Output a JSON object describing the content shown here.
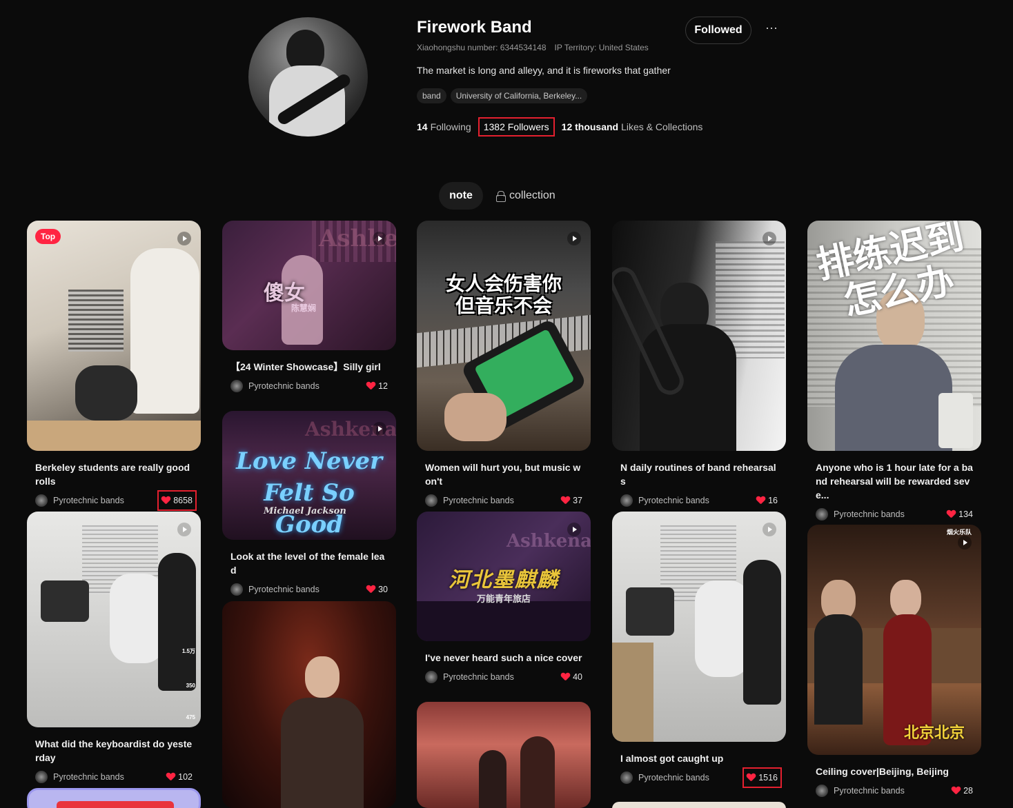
{
  "profile": {
    "name": "Firework Band",
    "xhs_number": "Xiaohongshu number: 6344534148",
    "ip": "IP Territory: United States",
    "description": "The market is long and alleyy, and it is fireworks that gather",
    "tags": [
      "band",
      "University of California, Berkeley..."
    ],
    "following_count": "14",
    "following_label": "Following",
    "followers_label": "1382 Followers",
    "likes_count": "12 thousand",
    "likes_label": "Likes & Collections",
    "followed_button": "Followed",
    "more_button": "···"
  },
  "tabs": {
    "note": "note",
    "collection": "collection"
  },
  "notes": [
    {
      "title": "Berkeley students are really good rolls",
      "author": "Pyrotechnic bands",
      "likes": "8658",
      "badge": "Top"
    },
    {
      "title": "What did the keyboardist do yesterday",
      "author": "Pyrotechnic bands",
      "likes": "102",
      "side_counts": [
        "1.5万",
        "350",
        "475"
      ]
    },
    {
      "title": "【24 Winter Showcase】Silly girl",
      "author": "Pyrotechnic bands",
      "likes": "12",
      "overlay": "傻女",
      "overlay_sub": "陈慧娴",
      "sign": "Ashke"
    },
    {
      "title": "Look at the level of the female lead",
      "author": "Pyrotechnic bands",
      "likes": "30",
      "overlay": "Love Never Felt So Good",
      "overlay_sub": "Michael Jackson",
      "sign": "Ashkenaz"
    },
    {
      "title": "Women will hurt you, but music won't",
      "author": "Pyrotechnic bands",
      "likes": "37",
      "overlay": "女人会伤害你 但音乐不会"
    },
    {
      "title": "I've never heard such a nice cover",
      "author": "Pyrotechnic bands",
      "likes": "40",
      "overlay": "河北墨麒麟",
      "overlay_sub": "万能青年旅店",
      "sign": "Ashkenaz"
    },
    {
      "title": "N daily routines of band rehearsals",
      "author": "Pyrotechnic bands",
      "likes": "16"
    },
    {
      "title": "I almost got caught up",
      "author": "Pyrotechnic bands",
      "likes": "1516"
    },
    {
      "title": "Anyone who is 1 hour late for a band rehearsal will be rewarded seve...",
      "author": "Pyrotechnic bands",
      "likes": "134",
      "overlay": "排练迟到怎么办"
    },
    {
      "title": "Ceiling cover|Beijing, Beijing",
      "author": "Pyrotechnic bands",
      "likes": "28",
      "overlay": "北京北京",
      "corner": "烟火乐队"
    }
  ],
  "colors": {
    "background": "#0b0b0b",
    "accent": "#ff2442",
    "highlight_box": "#e5202f"
  }
}
